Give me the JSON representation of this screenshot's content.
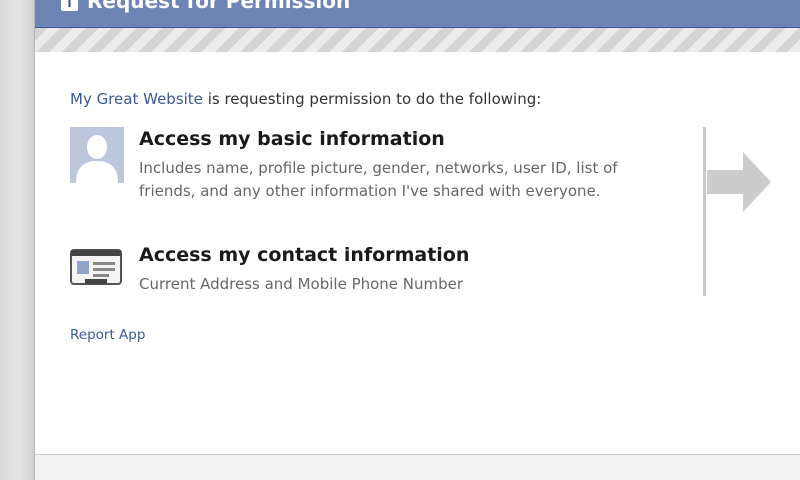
{
  "dialog": {
    "title": "Request for Permission",
    "title_icon": "facebook-f-icon",
    "intro": {
      "site_name": "My Great Website",
      "text": " is requesting permission to do the following:"
    },
    "permissions": [
      {
        "icon": "user-silhouette-icon",
        "title": "Access my basic information",
        "description": "Includes name, profile picture, gender, networks, user ID, list of friends, and any other information I've shared with everyone."
      },
      {
        "icon": "contact-card-icon",
        "title": "Access my contact information",
        "description": "Current Address and Mobile Phone Number"
      }
    ],
    "report_link": "Report App"
  },
  "colors": {
    "header_blue": "#6d84b4",
    "link_blue": "#3b5998",
    "avatar_bg": "#bcc7dd",
    "arrow_gray": "#cccccc"
  }
}
